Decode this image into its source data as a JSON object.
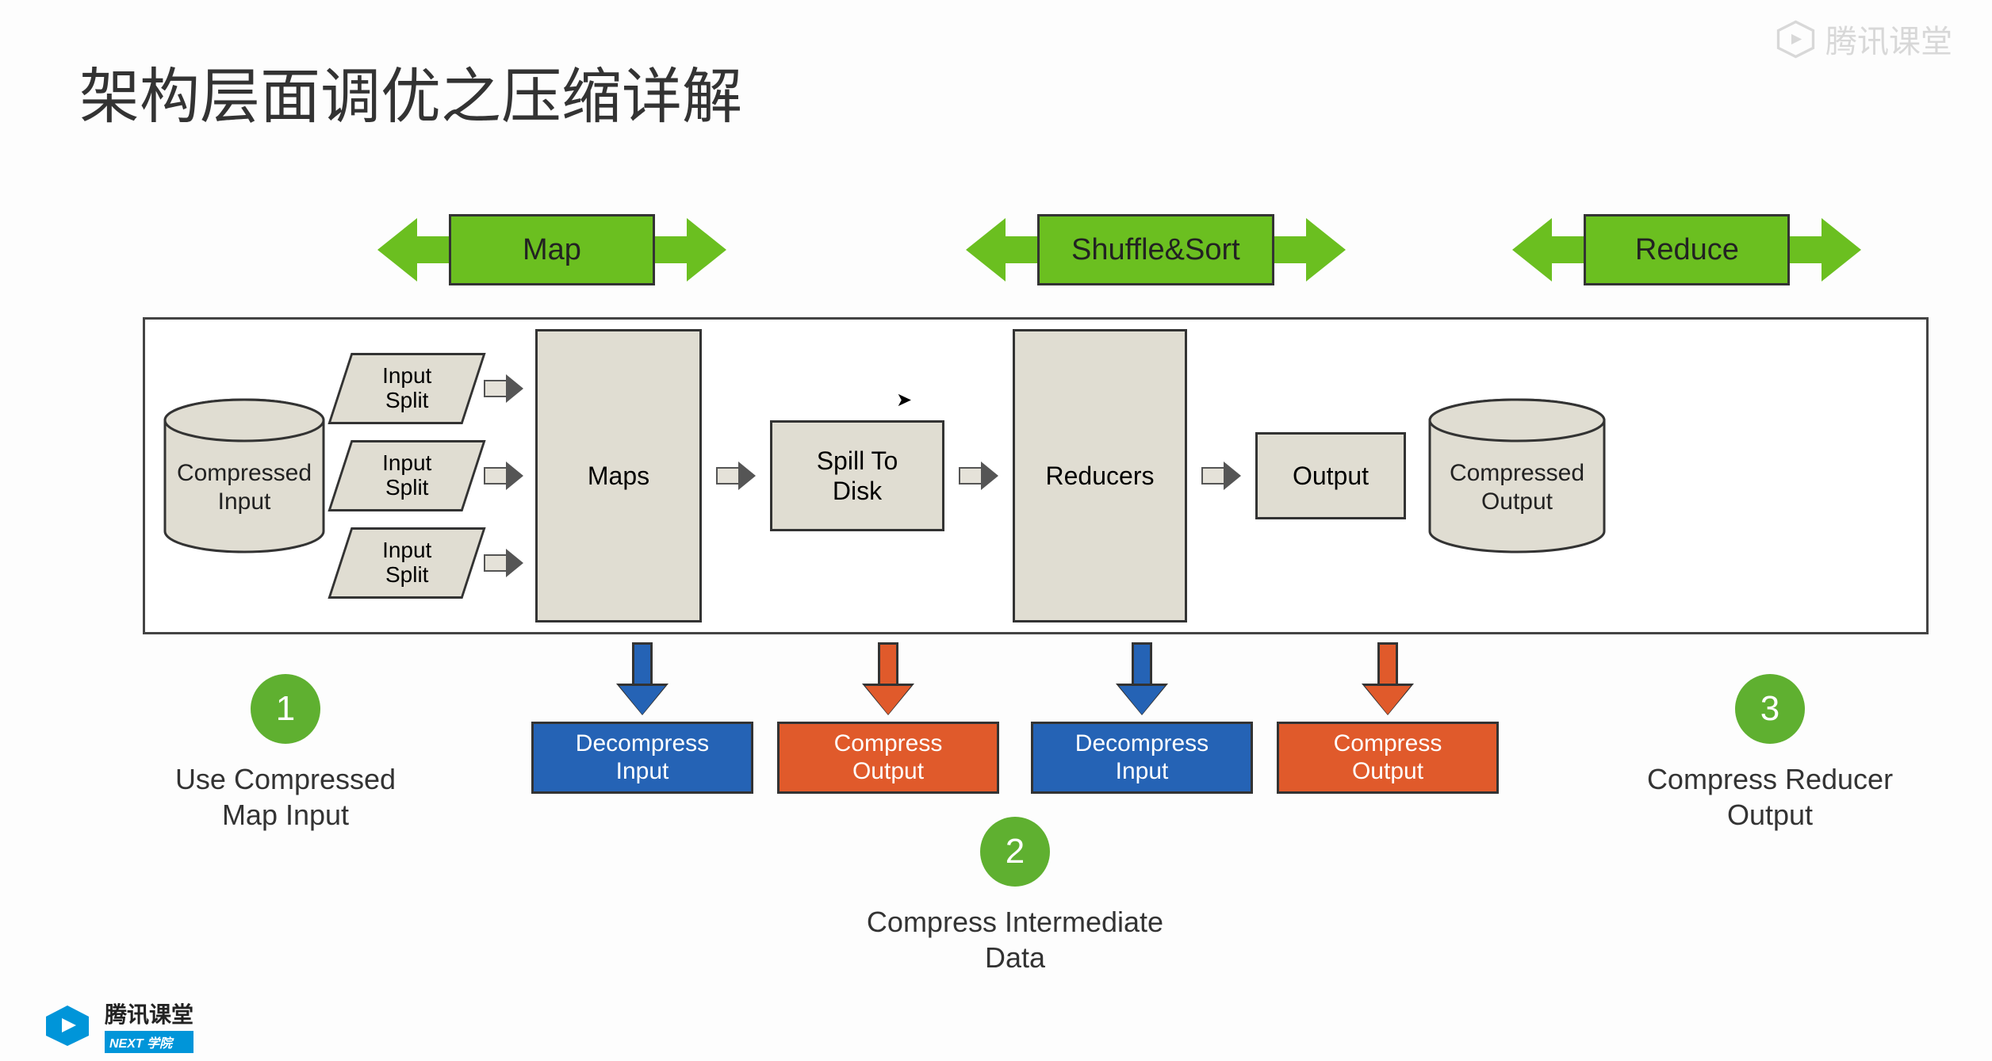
{
  "title": "架构层面调优之压缩详解",
  "watermark": "腾讯课堂",
  "phases": {
    "map": "Map",
    "shuffle": "Shuffle&Sort",
    "reduce": "Reduce"
  },
  "flow": {
    "compressed_input": "Compressed\nInput",
    "input_split": "Input\nSplit",
    "maps": "Maps",
    "spill": "Spill To\nDisk",
    "reducers": "Reducers",
    "output": "Output",
    "compressed_output": "Compressed\nOutput"
  },
  "actions": {
    "decompress_input": "Decompress\nInput",
    "compress_output": "Compress\nOutput"
  },
  "notes": {
    "n1": {
      "num": "1",
      "text": "Use Compressed\nMap Input"
    },
    "n2": {
      "num": "2",
      "text": "Compress Intermediate\nData"
    },
    "n3": {
      "num": "3",
      "text": "Compress Reducer\nOutput"
    }
  },
  "footer": {
    "brand": "腾讯课堂",
    "sub": "NEXT 学院"
  }
}
